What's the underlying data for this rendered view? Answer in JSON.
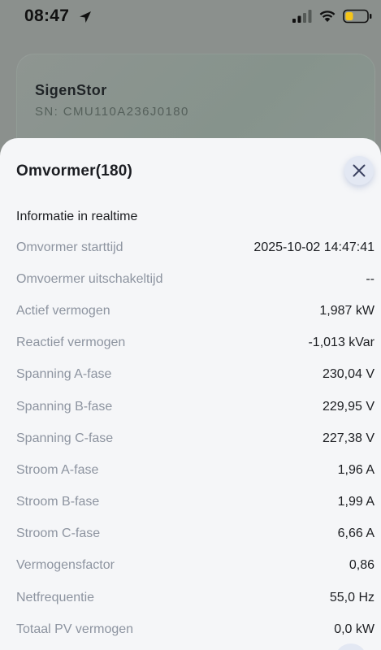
{
  "status_bar": {
    "time": "08:47",
    "location_icon": "location-arrow-icon",
    "signal_icon": "cellular-signal-icon",
    "wifi_icon": "wifi-icon",
    "battery_icon": "battery-low-icon"
  },
  "background_card": {
    "device_name": "SigenStor",
    "serial": "SN: CMU110A236J0180"
  },
  "sheet": {
    "title": "Omvormer(180)",
    "close_icon": "close-icon",
    "section_title": "Informatie in realtime",
    "rows": [
      {
        "label": "Omvormer starttijd",
        "value": "2025-10-02 14:47:41"
      },
      {
        "label": "Omvoermer uitschakeltijd",
        "value": "--"
      },
      {
        "label": "Actief vermogen",
        "value": "1,987 kW"
      },
      {
        "label": "Reactief vermogen",
        "value": "-1,013 kVar"
      },
      {
        "label": "Spanning A-fase",
        "value": "230,04 V"
      },
      {
        "label": "Spanning B-fase",
        "value": "229,95 V"
      },
      {
        "label": "Spanning C-fase",
        "value": "227,38 V"
      },
      {
        "label": "Stroom A-fase",
        "value": "1,96 A"
      },
      {
        "label": "Stroom B-fase",
        "value": "1,99 A"
      },
      {
        "label": "Stroom C-fase",
        "value": "6,66 A"
      },
      {
        "label": "Vermogensfactor",
        "value": "0,86"
      },
      {
        "label": "Netfrequentie",
        "value": "55,0 Hz"
      },
      {
        "label": "Totaal PV vermogen",
        "value": "0,0 kW"
      }
    ]
  },
  "colors": {
    "sheet_bg": "#f5f6f8",
    "label": "#8d94a0",
    "value": "#1c1e22",
    "close_bg": "#e3e8f3",
    "battery": "#f5c518"
  }
}
